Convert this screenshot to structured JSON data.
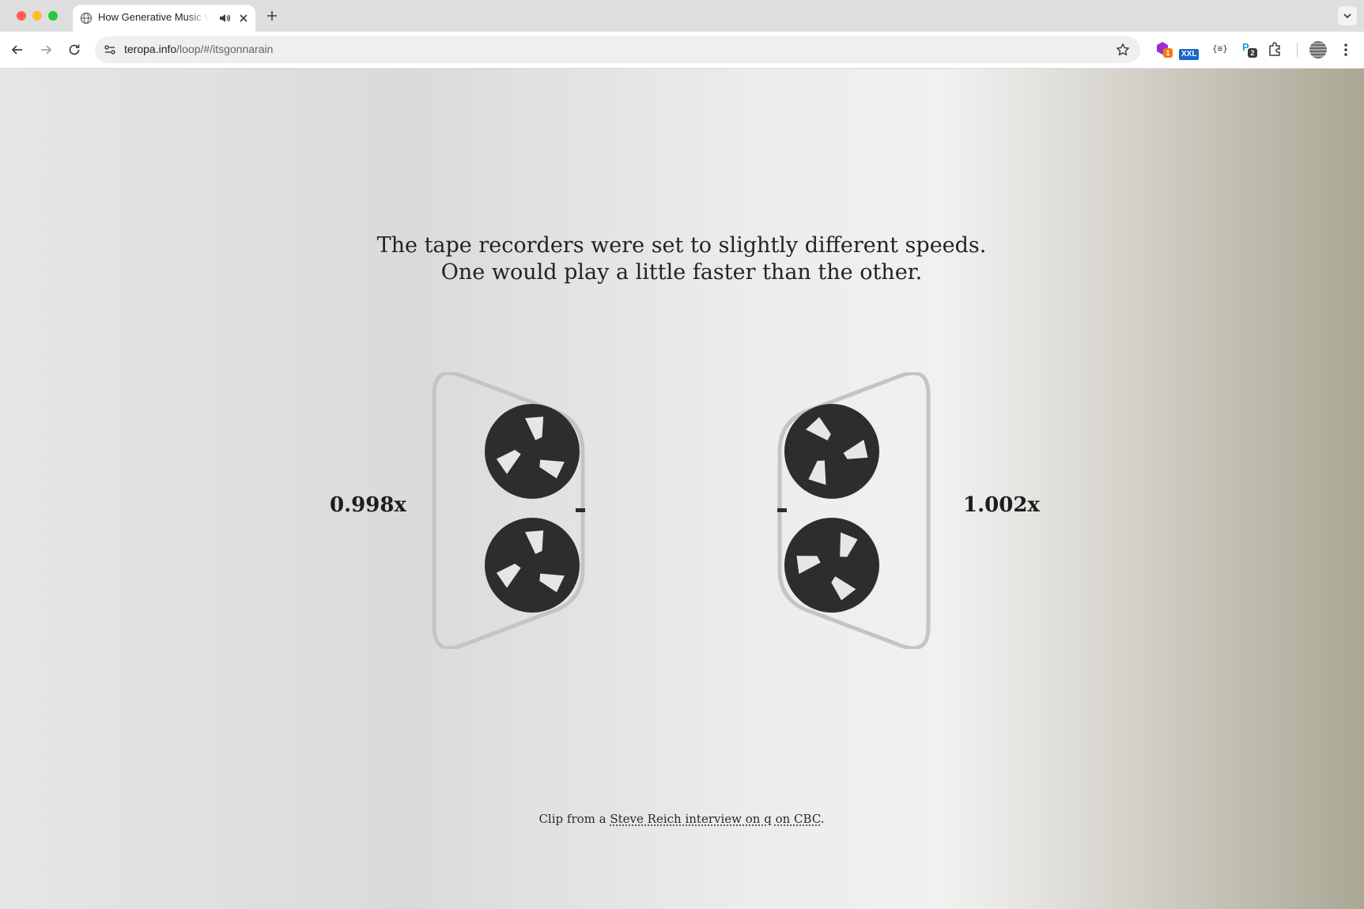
{
  "browser": {
    "tab": {
      "title": "How Generative Music Works",
      "icon": "globe-icon"
    },
    "url": {
      "host": "teropa.info",
      "path": "/loop/#/itsgonnarain"
    },
    "extensions": {
      "badge_1": "1",
      "xxl_label": "XXL",
      "code_label": "{≡}",
      "badge_2": "2"
    },
    "colors": {
      "close": "#ff5f57",
      "minimize": "#febc2e",
      "zoom": "#28c840"
    }
  },
  "page": {
    "headline_line1": "The tape recorders were set to slightly different speeds.",
    "headline_line2": "One would play a little faster than the other.",
    "left_speed": "0.998x",
    "right_speed": "1.002x",
    "caption_prefix": "Clip from a ",
    "caption_link": "Steve Reich interview on q on CBC",
    "caption_suffix": ".",
    "colors": {
      "reel": "#2d2d2d",
      "deck_outline": "#c4c4c4"
    }
  }
}
